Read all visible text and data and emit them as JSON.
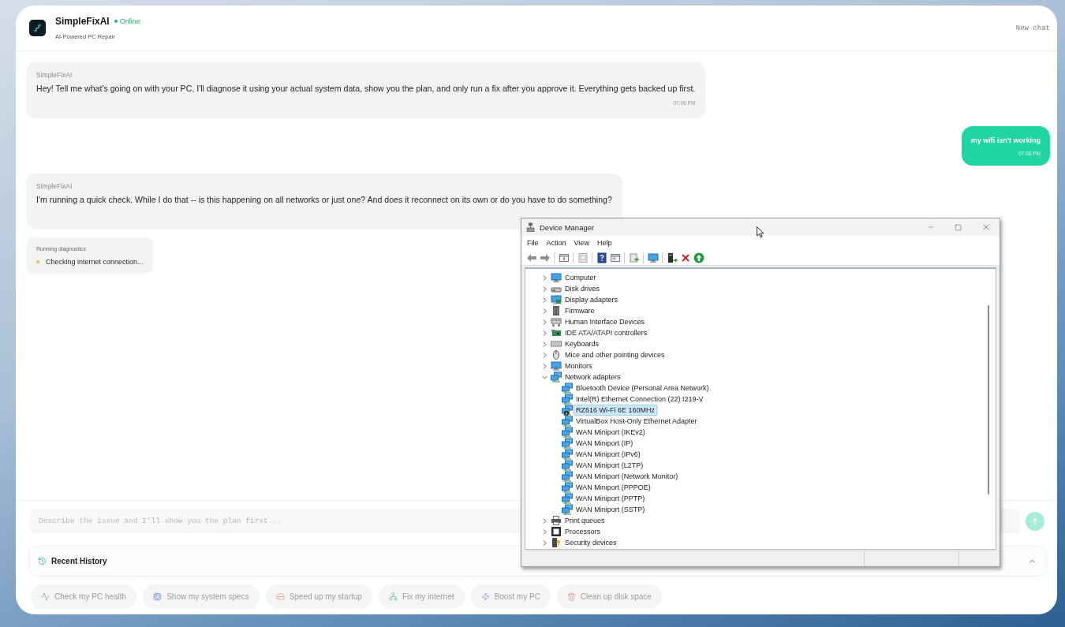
{
  "header": {
    "title": "SimpleFixAI",
    "status": "Online",
    "subtitle": "AI-Powered PC Repair",
    "new_chat": "New chat"
  },
  "messages": [
    {
      "kind": "assistant",
      "sender": "SimpleFixAI",
      "text": "Hey! Tell me what's going on with your PC. I'll diagnose it using your actual system data, show you the plan, and only run a fix after you approve it. Everything gets backed up first.",
      "time": "07:06 PM"
    },
    {
      "kind": "user",
      "text": "my wifi isn't working",
      "time": "07:08 PM"
    },
    {
      "kind": "assistant",
      "sender": "SimpleFixAI",
      "text": "I'm running a quick check. While I do that -- is this happening on all networks or just one? And does it reconnect on its own or do you have to do something?"
    }
  ],
  "diagnostics": {
    "title": "Running diagnostics",
    "step": "Checking internet connection..."
  },
  "composer": {
    "placeholder": "Describe the issue and I'll show you the plan first..."
  },
  "recent_history": {
    "label": "Recent History"
  },
  "suggestions": [
    {
      "kind": "health",
      "label": "Check my PC health"
    },
    {
      "kind": "specs",
      "label": "Show my system specs"
    },
    {
      "kind": "startup",
      "label": "Speed up my startup"
    },
    {
      "kind": "internet",
      "label": "Fix my internet"
    },
    {
      "kind": "boost",
      "label": "Boost my PC"
    },
    {
      "kind": "cleanup",
      "label": "Clean up disk space"
    }
  ],
  "device_manager": {
    "title": "Device Manager",
    "menu": [
      "File",
      "Action",
      "View",
      "Help"
    ],
    "tree": [
      {
        "label": "Computer",
        "kind": "computer",
        "expanded": false,
        "selected": false
      },
      {
        "label": "Disk drives",
        "kind": "disk",
        "expanded": false,
        "selected": false
      },
      {
        "label": "Display adapters",
        "kind": "display",
        "expanded": false,
        "selected": false
      },
      {
        "label": "Firmware",
        "kind": "firmware",
        "expanded": false,
        "selected": false
      },
      {
        "label": "Human Interface Devices",
        "kind": "hid",
        "expanded": false,
        "selected": false
      },
      {
        "label": "IDE ATA/ATAPI controllers",
        "kind": "ide",
        "expanded": false,
        "selected": false
      },
      {
        "label": "Keyboards",
        "kind": "keyboard",
        "expanded": false,
        "selected": false
      },
      {
        "label": "Mice and other pointing devices",
        "kind": "mouse",
        "expanded": false,
        "selected": false
      },
      {
        "label": "Monitors",
        "kind": "monitor",
        "expanded": false,
        "selected": false
      },
      {
        "label": "Network adapters",
        "kind": "network",
        "expanded": true,
        "selected": false,
        "children": [
          {
            "label": "Bluetooth Device (Personal Area Network)",
            "kind": "network",
            "selected": false,
            "disabled": false
          },
          {
            "label": "Intel(R) Ethernet Connection (22) I219-V",
            "kind": "network",
            "selected": false,
            "disabled": false
          },
          {
            "label": "RZ616 Wi-Fi 6E 160MHz",
            "kind": "network",
            "selected": true,
            "disabled": true
          },
          {
            "label": "VirtualBox Host-Only Ethernet Adapter",
            "kind": "network",
            "selected": false,
            "disabled": false
          },
          {
            "label": "WAN Miniport (IKEv2)",
            "kind": "network",
            "selected": false,
            "disabled": false
          },
          {
            "label": "WAN Miniport (IP)",
            "kind": "network",
            "selected": false,
            "disabled": false
          },
          {
            "label": "WAN Miniport (IPv6)",
            "kind": "network",
            "selected": false,
            "disabled": false
          },
          {
            "label": "WAN Miniport (L2TP)",
            "kind": "network",
            "selected": false,
            "disabled": false
          },
          {
            "label": "WAN Miniport (Network Monitor)",
            "kind": "network",
            "selected": false,
            "disabled": false
          },
          {
            "label": "WAN Miniport (PPPOE)",
            "kind": "network",
            "selected": false,
            "disabled": false
          },
          {
            "label": "WAN Miniport (PPTP)",
            "kind": "network",
            "selected": false,
            "disabled": false
          },
          {
            "label": "WAN Miniport (SSTP)",
            "kind": "network",
            "selected": false,
            "disabled": false
          }
        ]
      },
      {
        "label": "Print queues",
        "kind": "printer",
        "expanded": false,
        "selected": false
      },
      {
        "label": "Processors",
        "kind": "processor",
        "expanded": false,
        "selected": false
      },
      {
        "label": "Security devices",
        "kind": "security",
        "expanded": false,
        "selected": false
      }
    ]
  }
}
